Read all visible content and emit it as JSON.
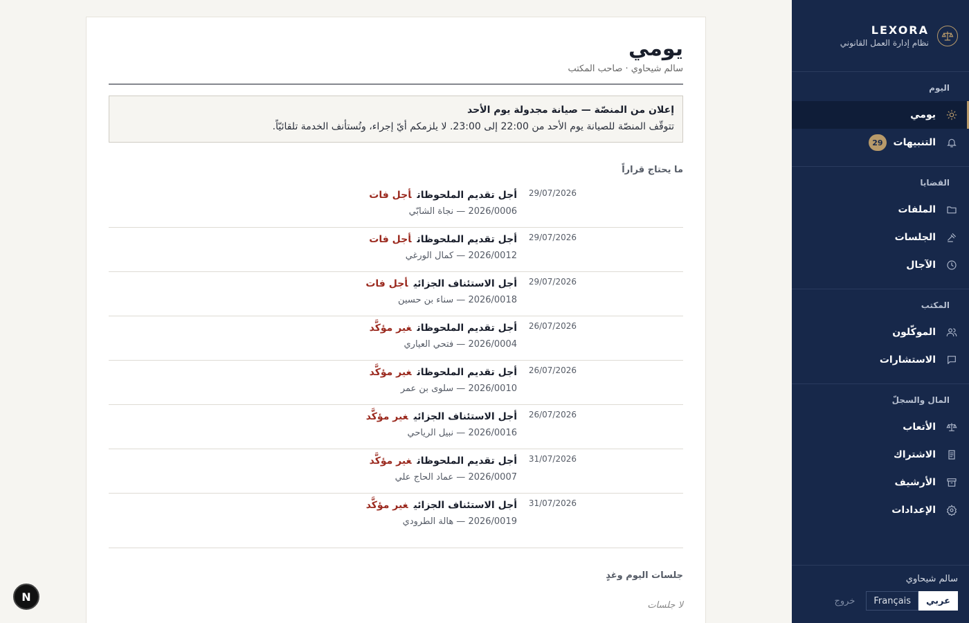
{
  "brand": {
    "name": "LEXORA",
    "subtitle": "نظام إدارة العمل القانوني",
    "logo_icon": "scales-icon"
  },
  "nav": {
    "today": {
      "title": "اليوم",
      "items": [
        {
          "label": "يومي",
          "icon": "sun-icon",
          "active": true
        },
        {
          "label": "التنبيهات",
          "icon": "bell-icon",
          "badge": "29"
        }
      ]
    },
    "cases": {
      "title": "القضايا",
      "items": [
        {
          "label": "الملفات",
          "icon": "folder-icon"
        },
        {
          "label": "الجلسات",
          "icon": "gavel-icon"
        },
        {
          "label": "الآجال",
          "icon": "clock-icon"
        }
      ]
    },
    "office": {
      "title": "المكتب",
      "items": [
        {
          "label": "الموكّلون",
          "icon": "users-icon"
        },
        {
          "label": "الاستشارات",
          "icon": "chat-icon"
        }
      ]
    },
    "finance": {
      "title": "المال والسجلّ",
      "items": [
        {
          "label": "الأتعاب",
          "icon": "scales-icon"
        },
        {
          "label": "الاشتراك",
          "icon": "document-icon"
        },
        {
          "label": "الأرشيف",
          "icon": "archive-icon"
        },
        {
          "label": "الإعدادات",
          "icon": "gear-icon"
        }
      ]
    }
  },
  "footer": {
    "user": "سالم شيحاوي",
    "lang_ar": "عربي",
    "lang_fr": "Français",
    "logout": "خروج"
  },
  "page": {
    "title": "يومي",
    "subtitle": "سالم شيحاوي · صاحب المكتب"
  },
  "notice": {
    "title": "إعلان من المنصّة — صيانة مجدولة يوم الأحد",
    "body": "تتوقّف المنصّة للصيانة يوم الأحد من 22:00 إلى 23:00. لا يلزمكم أيّ إجراء، وتُستأنف الخدمة تلقائيّاً."
  },
  "decisions": {
    "heading": "ما يحتاج قراراً",
    "rows": [
      {
        "title": "أجل تقديم الملحوظات",
        "status": "أجل فات",
        "meta": "2026/0006 — نجاة الشابّي",
        "date": "29/07/2026"
      },
      {
        "title": "أجل تقديم الملحوظات",
        "status": "أجل فات",
        "meta": "2026/0012 — كمال الورغي",
        "date": "29/07/2026"
      },
      {
        "title": "أجل الاستئناف الجزائي",
        "status": "أجل فات",
        "meta": "2026/0018 — سناء بن حسين",
        "date": "29/07/2026"
      },
      {
        "title": "أجل تقديم الملحوظات",
        "status": "غير مؤكَّد",
        "meta": "2026/0004 — فتحي العياري",
        "date": "26/07/2026"
      },
      {
        "title": "أجل تقديم الملحوظات",
        "status": "غير مؤكَّد",
        "meta": "2026/0010 — سلوى بن عمر",
        "date": "26/07/2026"
      },
      {
        "title": "أجل الاستئناف الجزائي",
        "status": "غير مؤكَّد",
        "meta": "2026/0016 — نبيل الرياحي",
        "date": "26/07/2026"
      },
      {
        "title": "أجل تقديم الملحوظات",
        "status": "غير مؤكَّد",
        "meta": "2026/0007 — عماد الحاج علي",
        "date": "31/07/2026"
      },
      {
        "title": "أجل الاستئناف الجزائي",
        "status": "غير مؤكَّد",
        "meta": "2026/0019 — هالة الطرودي",
        "date": "31/07/2026"
      }
    ]
  },
  "hearings": {
    "heading": "جلسات اليوم وغدٍ",
    "empty": "لا جلسات"
  },
  "dev_badge": "N",
  "colors": {
    "sidebar_bg": "#17284a",
    "accent_gold": "#b89a6a",
    "status_red": "#9b2a1f"
  }
}
